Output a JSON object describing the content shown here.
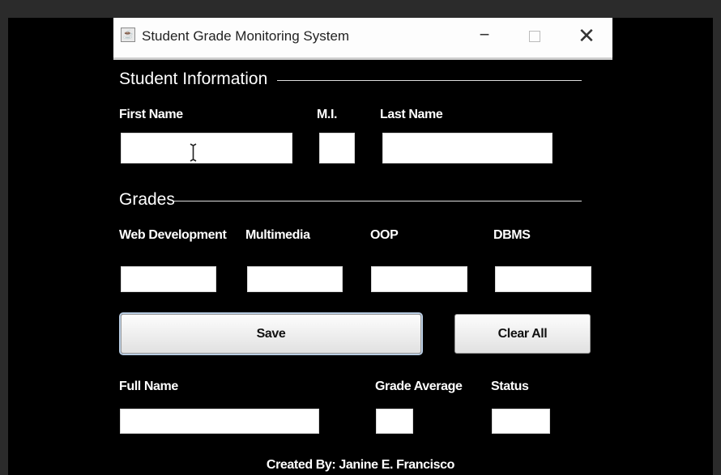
{
  "window": {
    "title": "Student Grade Monitoring System",
    "app_icon": "java-icon",
    "controls": {
      "minimize": "minimize-icon",
      "maximize": "maximize-icon",
      "close": "close-icon"
    }
  },
  "student_information": {
    "section_title": "Student Information",
    "first_name": {
      "label": "First Name",
      "value": ""
    },
    "middle_initial": {
      "label": "M.I.",
      "value": ""
    },
    "last_name": {
      "label": "Last Name",
      "value": ""
    }
  },
  "grades": {
    "section_title": "Grades",
    "web_development": {
      "label": "Web Development",
      "value": ""
    },
    "multimedia": {
      "label": "Multimedia",
      "value": ""
    },
    "oop": {
      "label": "OOP",
      "value": ""
    },
    "dbms": {
      "label": "DBMS",
      "value": ""
    }
  },
  "actions": {
    "save_label": "Save",
    "clear_label": "Clear All"
  },
  "results": {
    "full_name": {
      "label": "Full Name",
      "value": ""
    },
    "grade_average": {
      "label": "Grade Average",
      "value": ""
    },
    "status": {
      "label": "Status",
      "value": ""
    }
  },
  "footer": {
    "credit": "Created By: Janine E. Francisco"
  },
  "colors": {
    "window_background": "#000000",
    "text": "#ffffff",
    "field_background": "#ffffff"
  }
}
